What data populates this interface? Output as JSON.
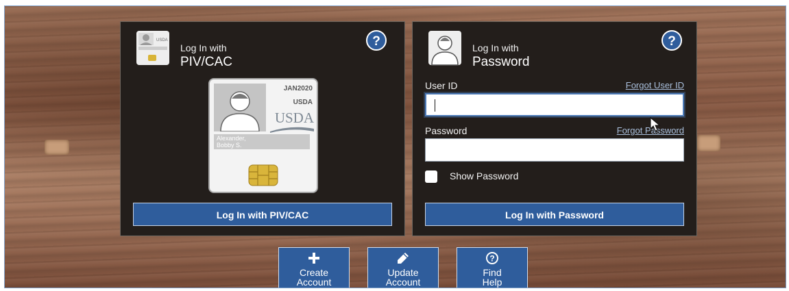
{
  "piv_panel": {
    "title_small": "Log In with",
    "title_big": "PIV/CAC",
    "help_label": "?",
    "card": {
      "date": "JAN2020",
      "agency": "USDA",
      "logo": "USDA",
      "name": "Alexander,\nBobby S."
    },
    "button_label": "Log In with PIV/CAC"
  },
  "password_panel": {
    "title_small": "Log In with",
    "title_big": "Password",
    "help_label": "?",
    "user_id_label": "User ID",
    "forgot_user_id": "Forgot User ID",
    "user_id_value": "",
    "password_label": "Password",
    "forgot_password": "Forgot Password",
    "password_value": "",
    "show_password_label": "Show Password",
    "show_password_checked": false,
    "button_label": "Log In with Password"
  },
  "tiles": [
    {
      "icon": "plus-icon",
      "label": "Create\nAccount"
    },
    {
      "icon": "pencil-icon",
      "label": "Update\nAccount"
    },
    {
      "icon": "question-circle-icon",
      "label": "Find\nHelp"
    }
  ],
  "colors": {
    "accent_blue": "#2f5d9c",
    "panel_bg": "#231e1b",
    "link": "#aac0dd"
  }
}
